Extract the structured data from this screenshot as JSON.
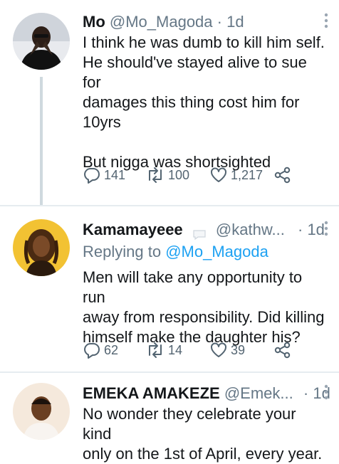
{
  "tweets": [
    {
      "name": "Mo",
      "handle": "@Mo_Magoda",
      "dot": "·",
      "time": "1d",
      "body": "I think he was dumb to kill him self.\nHe should've stayed alive to sue for\ndamages this thing cost him for\n10yrs\n\nBut nigga was shortsighted",
      "replies": "141",
      "retweets": "100",
      "likes": "1,217"
    },
    {
      "name": "Kamamayeee",
      "handle": "@kathw...",
      "dot": "·",
      "time": "1d",
      "replying_prefix": "Replying to ",
      "replying_to": "@Mo_Magoda",
      "body": "Men will take any opportunity to run\naway from responsibility. Did killing\nhimself make the daughter his?",
      "replies": "62",
      "retweets": "14",
      "likes": "39"
    },
    {
      "name": "EMEKA AMAKEZE",
      "handle": "@Emek...",
      "dot": "·",
      "time": "1d",
      "body": "No wonder they celebrate your kind\nonly on the 1st of April, every year."
    }
  ],
  "icons": {
    "reply": "reply-icon",
    "retweet": "retweet-icon",
    "like": "heart-icon",
    "share": "share-icon",
    "more": "more-vertical-icon"
  },
  "colors": {
    "link": "#1da1f2",
    "secondary_text": "#657786",
    "divider": "#e6ecf0"
  }
}
